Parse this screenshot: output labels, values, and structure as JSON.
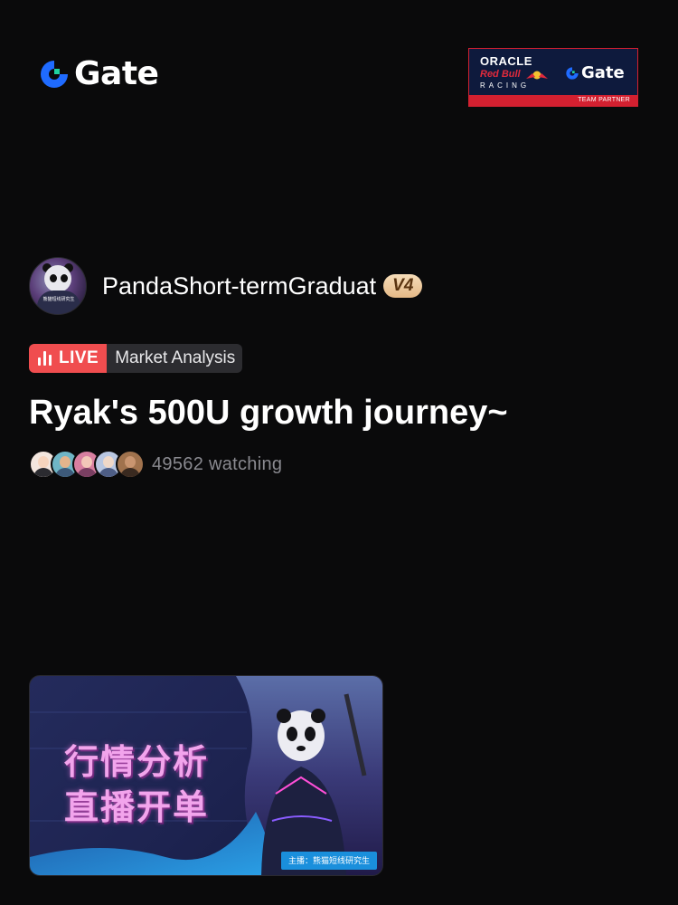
{
  "header": {
    "logo_text": "Gate",
    "logo_icon": "gate-logo-icon",
    "partner": {
      "oracle": "ORACLE",
      "redbull": "Red Bull",
      "racing": "RACING",
      "gate": "Gate",
      "team_partner": "TEAM PARTNER"
    }
  },
  "host": {
    "name": "PandaShort-termGraduat",
    "level": "V4",
    "avatar_caption": "熊猫短线研究生"
  },
  "stream": {
    "live_label": "LIVE",
    "category": "Market Analysis",
    "title": "Ryak's 500U growth journey~",
    "viewers": "49562 watching"
  },
  "thumbnail": {
    "line1": "行情分析",
    "line2": "直播开单",
    "host_label": "主播：熊猫短线研究生"
  },
  "colors": {
    "background": "#0a0a0b",
    "live_red": "#f04d4f",
    "badge_gold": "#e5b987",
    "gate_blue": "#1f6bff"
  }
}
